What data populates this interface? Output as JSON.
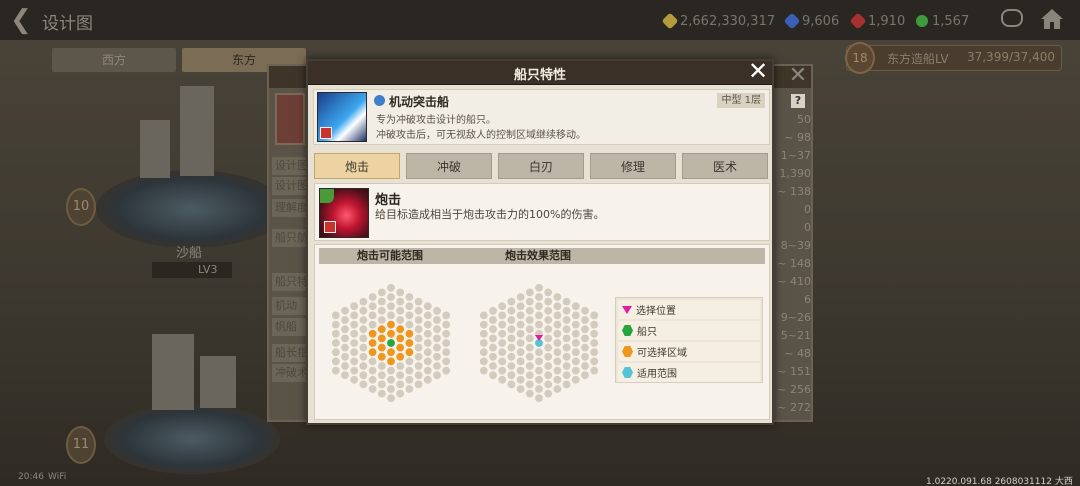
{
  "topbar": {
    "title": "设计图",
    "resources": [
      {
        "icon": "gold-coin-icon",
        "value": "2,662,330,317",
        "color": "#b59b3c"
      },
      {
        "icon": "blue-gem-icon",
        "value": "9,606",
        "color": "#3b5fb5"
      },
      {
        "icon": "red-gem-icon",
        "value": "1,910",
        "color": "#a83030"
      },
      {
        "icon": "green-token-icon",
        "value": "1,567",
        "color": "#3f9a3c"
      }
    ]
  },
  "background": {
    "tabs": [
      "西方",
      "东方"
    ],
    "active_tab": 1,
    "shipyard": {
      "level": "18",
      "label": "东方造船LV",
      "value": "37,399/37,400"
    },
    "ship_level_top": "10",
    "ship_level_bottom": "11",
    "ship_name": "沙船",
    "ship_lv": "LV3",
    "left_rows": [
      "设计图",
      "设计图",
      "理解度",
      "船只航",
      "船只特",
      "机动",
      "帆船",
      "船长指",
      "冲破术"
    ],
    "right_stats": [
      "50",
      "~ 98",
      "1~37",
      "1,390",
      "~ 138",
      "0",
      "0",
      "8~39",
      "~ 148",
      "~ 410",
      "6",
      "9~26",
      "5~21",
      "~ 48",
      "~ 151",
      "~ 256",
      "~ 272"
    ],
    "help_button": "?",
    "status_time": "20:46",
    "status_wifi": "WiFi",
    "version": "1.0220.091.68 2608031112 大西洋"
  },
  "modal": {
    "title": "船只特性",
    "ship": {
      "name": "机动突击船",
      "class": "中型 1层",
      "desc1": "专为冲破攻击设计的船只。",
      "desc2": "冲破攻击后，可无视敌人的控制区域继续移动。"
    },
    "tabs": [
      "炮击",
      "冲破",
      "白刃",
      "修理",
      "医术"
    ],
    "active_tab": 0,
    "skill": {
      "name": "炮击",
      "desc": "给目标造成相当于炮击攻击力的100%的伤害。"
    },
    "range": {
      "possible_title": "炮击可能范围",
      "effect_title": "炮击效果范围",
      "legend": [
        {
          "label": "选择位置",
          "shape": "triangle",
          "color": "#e11c9e"
        },
        {
          "label": "船只",
          "shape": "hex",
          "color": "#25a63c"
        },
        {
          "label": "可选择区域",
          "shape": "hex",
          "color": "#f0961e"
        },
        {
          "label": "适用范围",
          "shape": "hex",
          "color": "#55c3d6"
        }
      ]
    }
  }
}
